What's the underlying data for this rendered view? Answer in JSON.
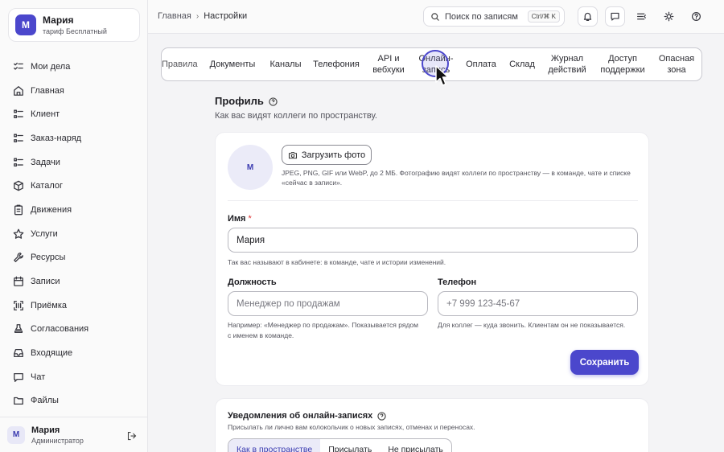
{
  "workspace": {
    "avatar": "М",
    "name": "Мария",
    "plan": "тариф Бесплатный"
  },
  "sidebar": {
    "items": [
      {
        "label": "Мои дела",
        "icon": "list-check-icon"
      },
      {
        "label": "Главная",
        "icon": "home-icon"
      },
      {
        "label": "Клиент",
        "icon": "list-icon"
      },
      {
        "label": "Заказ-наряд",
        "icon": "list-icon"
      },
      {
        "label": "Задачи",
        "icon": "list-icon"
      },
      {
        "label": "Каталог",
        "icon": "box-icon"
      },
      {
        "label": "Движения",
        "icon": "clipboard-icon"
      },
      {
        "label": "Услуги",
        "icon": "star-icon"
      },
      {
        "label": "Ресурсы",
        "icon": "wrench-icon"
      },
      {
        "label": "Записи",
        "icon": "calendar-icon"
      },
      {
        "label": "Приёмка",
        "icon": "scan-icon"
      },
      {
        "label": "Согласования",
        "icon": "stamp-icon"
      },
      {
        "label": "Входящие",
        "icon": "inbox-icon"
      },
      {
        "label": "Чат",
        "icon": "chat-icon"
      },
      {
        "label": "Файлы",
        "icon": "folder-icon"
      }
    ],
    "user": {
      "avatar": "М",
      "name": "Мария",
      "role": "Администратор"
    }
  },
  "topbar": {
    "breadcrumb": [
      "Главная",
      "Настройки"
    ],
    "search_placeholder": "Поиск по записям",
    "search_shortcut": "Ctrl/⌘ K"
  },
  "tabs": [
    "Правила",
    "Документы",
    "Каналы",
    "Телефония",
    "API и вебхуки",
    "Онлайн-запись",
    "Оплата",
    "Склад",
    "Журнал действий",
    "Доступ поддержки",
    "Опасная зона"
  ],
  "profile": {
    "title": "Профиль",
    "subtitle": "Как вас видят коллеги по пространству.",
    "avatar": "М",
    "upload_label": "Загрузить фото",
    "upload_hint": "JPEG, PNG, GIF или WebP, до 2 МБ. Фотографию видят коллеги по пространству — в команде, чате и списке «сейчас в записи».",
    "name_label": "Имя",
    "name_required": "*",
    "name_value": "Мария",
    "name_hint": "Так вас называют в кабинете: в команде, чате и истории изменений.",
    "position_label": "Должность",
    "position_placeholder": "Менеджер по продажам",
    "position_hint": "Например: «Менеджер по продажам». Показывается рядом с именем в команде.",
    "phone_label": "Телефон",
    "phone_placeholder": "+7 999 123-45-67",
    "phone_hint": "Для коллег — куда звонить. Клиентам он не показывается.",
    "save_label": "Сохранить"
  },
  "notifications": {
    "title": "Уведомления об онлайн-записях",
    "subtitle": "Присылать ли лично вам колокольчик о новых записях, отменах и переносах.",
    "options": [
      "Как в пространстве",
      "Присылать",
      "Не присылать"
    ]
  },
  "colors": {
    "accent": "#4b47cc",
    "sidebar_bg": "#fafafa",
    "page_bg": "#f4f4f6"
  }
}
